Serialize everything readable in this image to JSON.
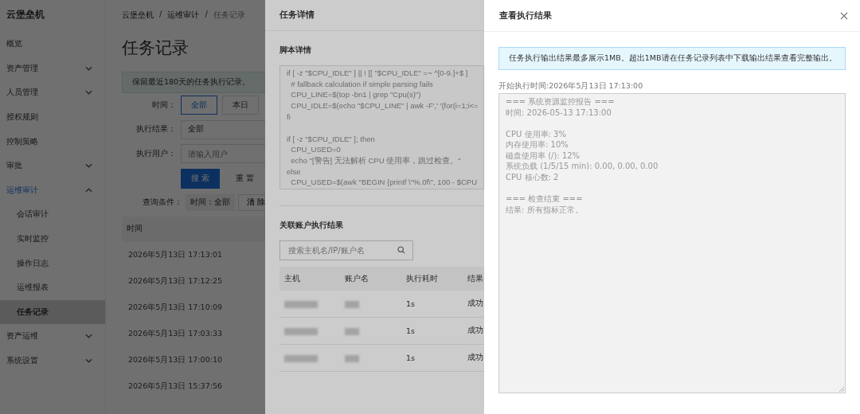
{
  "sidebar": {
    "brand": "云堡垒机",
    "items": [
      {
        "label": "概览",
        "kind": "link",
        "selected": false
      },
      {
        "label": "资产管理",
        "kind": "group",
        "expanded": false
      },
      {
        "label": "人员管理",
        "kind": "group",
        "expanded": false
      },
      {
        "label": "授权规则",
        "kind": "link",
        "selected": false
      },
      {
        "label": "控制策略",
        "kind": "link",
        "selected": false
      },
      {
        "label": "审批",
        "kind": "group",
        "expanded": false
      },
      {
        "label": "运维审计",
        "kind": "group",
        "expanded": true,
        "children": [
          {
            "label": "会话审计",
            "selected": false
          },
          {
            "label": "实时监控",
            "selected": false
          },
          {
            "label": "操作日志",
            "selected": false
          },
          {
            "label": "运维报表",
            "selected": false
          },
          {
            "label": "任务记录",
            "selected": true
          }
        ]
      },
      {
        "label": "资产运维",
        "kind": "group",
        "expanded": false
      },
      {
        "label": "系统设置",
        "kind": "group",
        "expanded": false
      }
    ]
  },
  "main": {
    "breadcrumb": [
      "云堡垒机",
      "运维审计",
      "任务记录"
    ],
    "breadcrumb_separator": "/",
    "title": "任务记录",
    "notice": "保留最近180天的任务执行记录。",
    "filters": {
      "time_label": "时间：",
      "time_options": [
        {
          "label": "全部",
          "selected": true
        },
        {
          "label": "本日",
          "selected": false
        }
      ],
      "result_label": "执行结果：",
      "result_value": "全部",
      "user_label": "执行用户：",
      "user_placeholder": "请输入用户",
      "search_button": "搜 索",
      "reset_button": "重 置",
      "conditions_label": "查询条件：",
      "condition_tag": "时间：全部",
      "clear_button": "清 除"
    },
    "table": {
      "columns": [
        "时间"
      ],
      "rows": [
        "2026年5月13日 17:13:01",
        "2026年5月13日 17:12:25",
        "2026年5月13日 17:10:09",
        "2026年5月13日 17:03:33",
        "2026年5月13日 17:00:10",
        "2026年5月13日 15:37:56"
      ]
    }
  },
  "task_drawer": {
    "title": "任务详情",
    "script_heading": "脚本详情",
    "script_blocks": [
      [
        "if [ -z \"$CPU_IDLE\" ] || ! [[ \"$CPU_IDLE\" =~ ^[0-9.]+$ ]",
        "  # fallback calculation if simple parsing fails",
        "  CPU_LINE=$(top -bn1 | grep \"Cpu(s)\")",
        "  CPU_IDLE=$(echo \"$CPU_LINE\" | awk -F',' '{for(i=1;i<=",
        "fi"
      ],
      [
        "if [ -z \"$CPU_IDLE\" ]; then",
        "  CPU_USED=0",
        "  echo \"[警告] 无法解析 CPU 使用率，跳过检查。\"",
        "else",
        "  CPU_USED=$(awk \"BEGIN {printf \\\"%.0f\\\", 100 - $CPU"
      ]
    ],
    "results_heading": "关联账户执行结果",
    "search_placeholder": "搜索主机名/IP/账户名",
    "columns": [
      "主机",
      "账户名",
      "执行耗时",
      "结果"
    ],
    "rows": [
      {
        "duration": "1s",
        "result": "成功"
      },
      {
        "duration": "1s",
        "result": "成功"
      },
      {
        "duration": "1s",
        "result": "成功"
      }
    ]
  },
  "result_drawer": {
    "title": "查看执行结果",
    "notice": "任务执行输出结果最多展示1MB。超出1MB请在任务记录列表中下载输出结果查看完整输出。",
    "start_time": "开始执行时间:2026年5月13日 17:13:00",
    "output_blocks": [
      [
        "=== 系统资源监控报告 ===",
        "时间: 2026-05-13 17:13:00"
      ],
      [
        "CPU 使用率: 3%",
        "内存使用率: 10%",
        "磁盘使用率 (/): 12%",
        "系统负载 (1/5/15 min): 0.00, 0.00, 0.00",
        "CPU 核心数: 2"
      ],
      [
        "=== 检查结束 ===",
        "结果: 所有指标正常。"
      ]
    ]
  }
}
